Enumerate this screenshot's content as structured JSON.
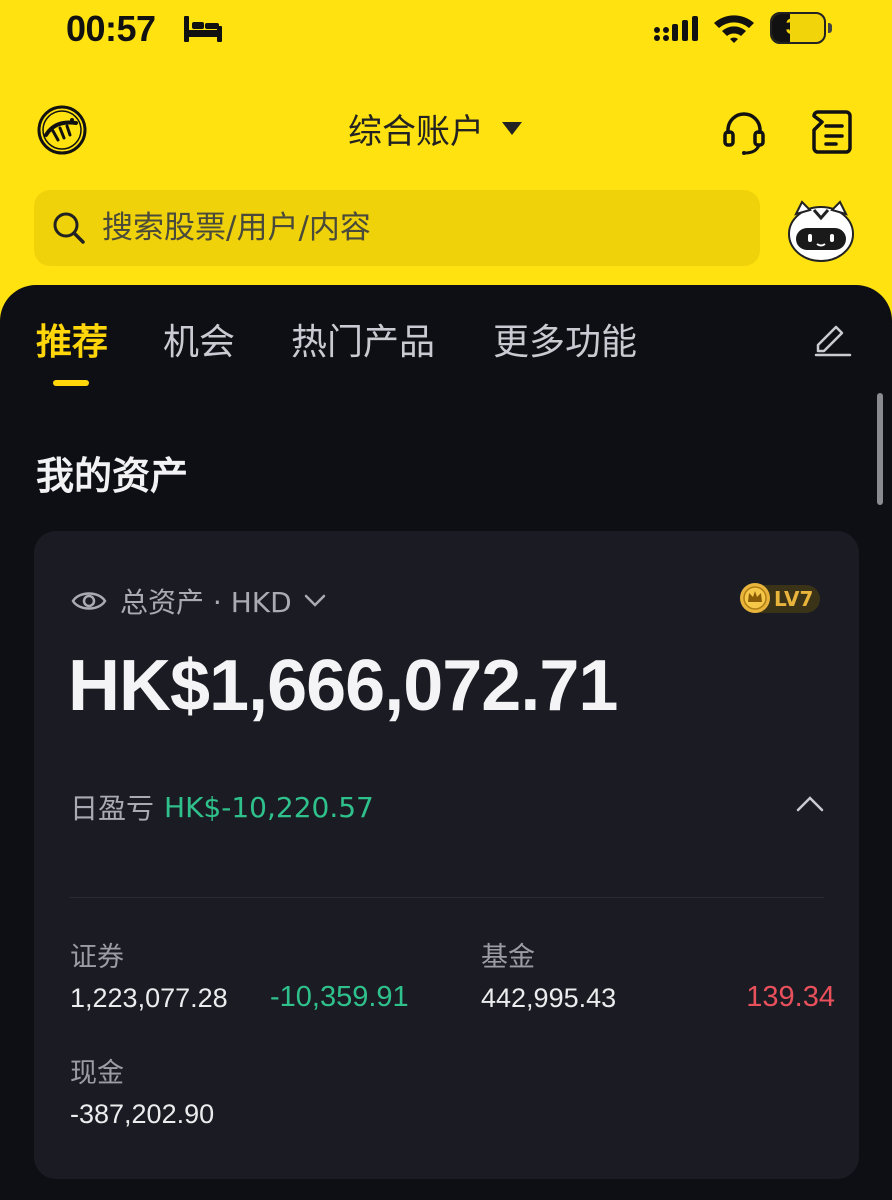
{
  "status_bar": {
    "time": "00:57",
    "battery_level": "34",
    "battery_fraction": 0.34
  },
  "header": {
    "account_title": "综合账户"
  },
  "search": {
    "placeholder": "搜索股票/用户/内容"
  },
  "tabs": [
    {
      "label": "推荐",
      "active": true
    },
    {
      "label": "机会",
      "active": false
    },
    {
      "label": "热门产品",
      "active": false
    },
    {
      "label": "更多功能",
      "active": false
    }
  ],
  "assets": {
    "section_title": "我的资产",
    "total_label": "总资产 · HKD",
    "level": "LV7",
    "total_amount": "HK$1,666,072.71",
    "daily_pl_label": "日盈亏",
    "daily_pl_value": "HK$-10,220.57",
    "securities": {
      "label": "证券",
      "value": "1,223,077.28",
      "change": "-10,359.91"
    },
    "funds": {
      "label": "基金",
      "value": "442,995.43",
      "change": "139.34"
    },
    "cash": {
      "label": "现金",
      "value": "-387,202.90"
    }
  },
  "colors": {
    "brand_yellow": "#FFE20F",
    "panel_bg": "#0E0F14",
    "card_bg": "#1B1C23",
    "accent": "#FFD60A",
    "loss_green": "#2FC18C",
    "gain_red": "#E8505B"
  }
}
